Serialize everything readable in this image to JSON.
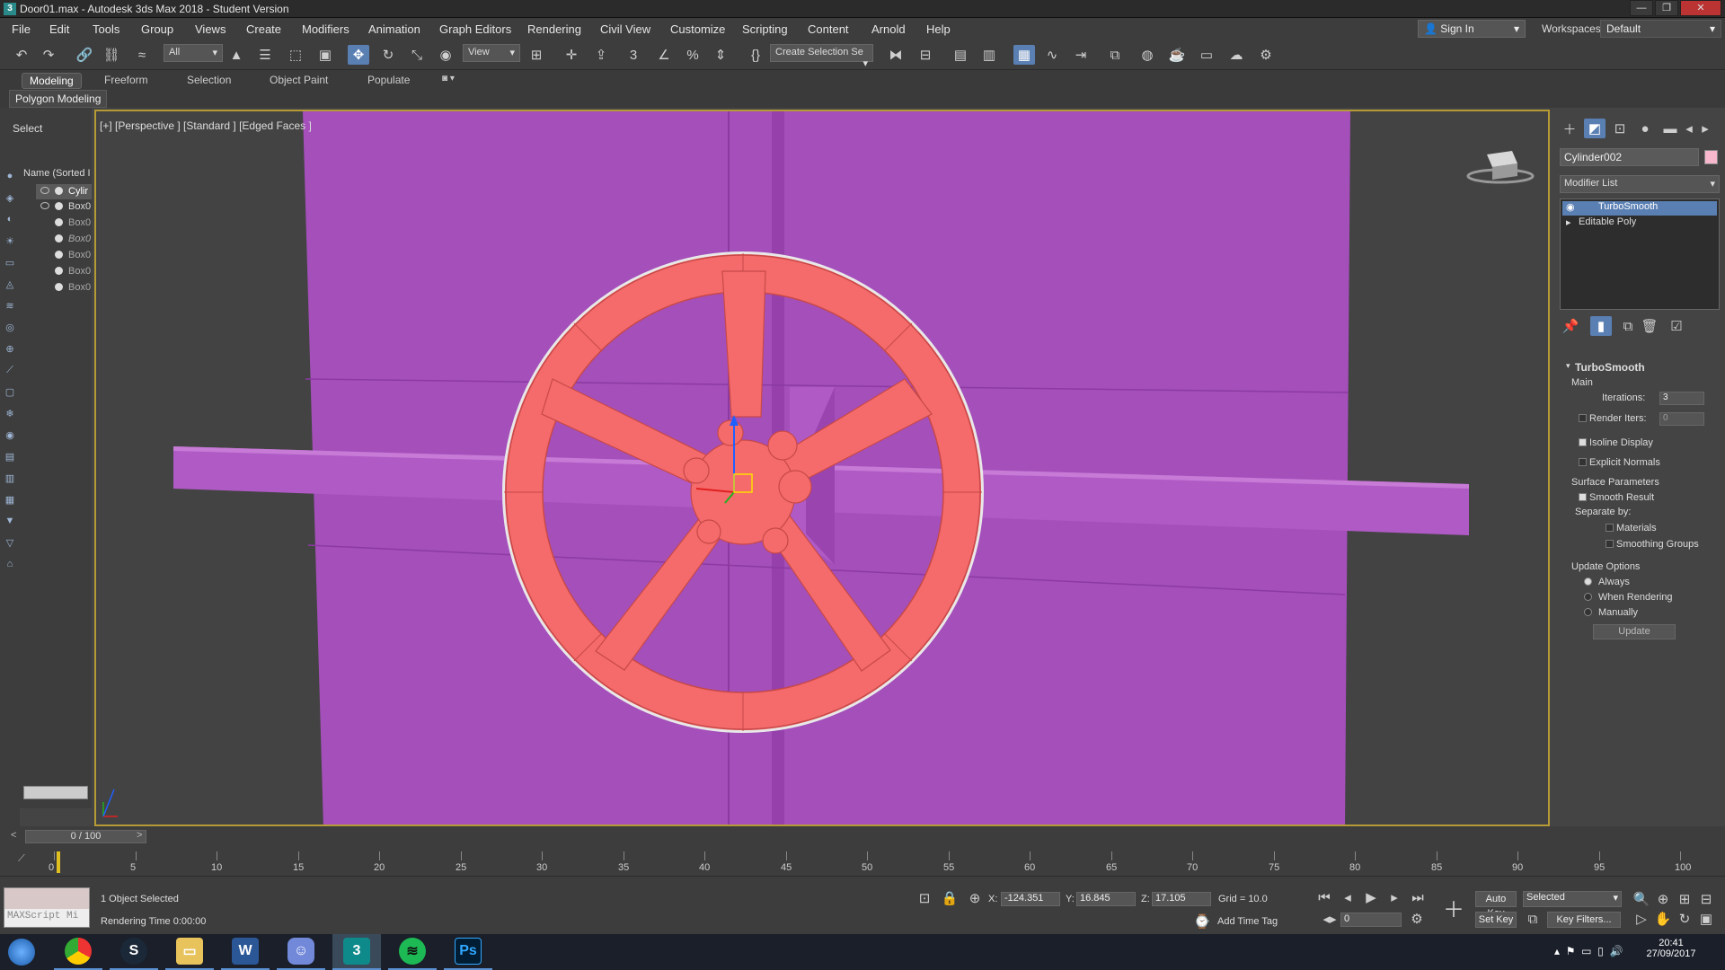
{
  "window": {
    "title": "Door01.max - Autodesk 3ds Max 2018 - Student Version"
  },
  "menu": [
    "File",
    "Edit",
    "Tools",
    "Group",
    "Views",
    "Create",
    "Modifiers",
    "Animation",
    "Graph Editors",
    "Rendering",
    "Civil View",
    "Customize",
    "Scripting",
    "Content",
    "Arnold",
    "Help"
  ],
  "account": {
    "sign_in": "Sign In",
    "workspaces_label": "Workspaces:",
    "workspace": "Default"
  },
  "toolbar": {
    "filter": "All",
    "ref_coord": "View",
    "selection_set": "Create Selection Se"
  },
  "ribbon": {
    "tabs": [
      "Modeling",
      "Freeform",
      "Selection",
      "Object Paint",
      "Populate"
    ],
    "active_panel": "Polygon Modeling"
  },
  "scene_explorer": {
    "title": "Select",
    "column": "Name (Sorted I",
    "items": [
      "Cylir",
      "Box0",
      "Box0",
      "Box0",
      "Box0",
      "Box0",
      "Box0"
    ]
  },
  "viewport": {
    "label": "[+] [Perspective ] [Standard ] [Edged Faces ]"
  },
  "command_panel": {
    "object_name": "Cylinder002",
    "object_color": "#f7b7cd",
    "modifier_list": "Modifier List",
    "stack": [
      "TurboSmooth",
      "Editable Poly"
    ],
    "rollout": {
      "title": "TurboSmooth",
      "main": "Main",
      "iterations_label": "Iterations:",
      "iterations": "3",
      "render_iters_label": "Render Iters:",
      "render_iters": "0",
      "isoline": "Isoline Display",
      "explicit_normals": "Explicit Normals",
      "surface_params": "Surface Parameters",
      "smooth_result": "Smooth Result",
      "separate_by": "Separate by:",
      "materials": "Materials",
      "smoothing_groups": "Smoothing Groups",
      "update_options": "Update Options",
      "always": "Always",
      "when_rendering": "When Rendering",
      "manually": "Manually",
      "update": "Update"
    }
  },
  "timeline": {
    "frame": "0 / 100",
    "ticks": [
      "0",
      "5",
      "10",
      "15",
      "20",
      "25",
      "30",
      "35",
      "40",
      "45",
      "50",
      "55",
      "60",
      "65",
      "70",
      "75",
      "80",
      "85",
      "90",
      "95",
      "100"
    ]
  },
  "status": {
    "maxscript": "MAXScript Mi",
    "selected": "1 Object Selected",
    "render_time": "Rendering Time 0:00:00",
    "x_label": "X:",
    "x": "-124.351",
    "y_label": "Y:",
    "y": "16.845",
    "z_label": "Z:",
    "z": "17.105",
    "grid": "Grid = 10.0",
    "add_time_tag": "Add Time Tag",
    "auto_key": "Auto Key",
    "key_mode": "Selected",
    "set_key": "Set Key",
    "key_filters": "Key Filters...",
    "frame_field": "0"
  },
  "taskbar": {
    "time": "20:41",
    "date": "27/09/2017",
    "apps": [
      "chrome-icon",
      "steam-icon",
      "explorer-icon",
      "word-icon",
      "discord-icon",
      "3dsmax-icon",
      "spotify-icon",
      "photoshop-icon"
    ]
  },
  "colors": {
    "door": "#a44fba",
    "wheel": "#f56b6b",
    "selection": "#5a7fb3"
  }
}
